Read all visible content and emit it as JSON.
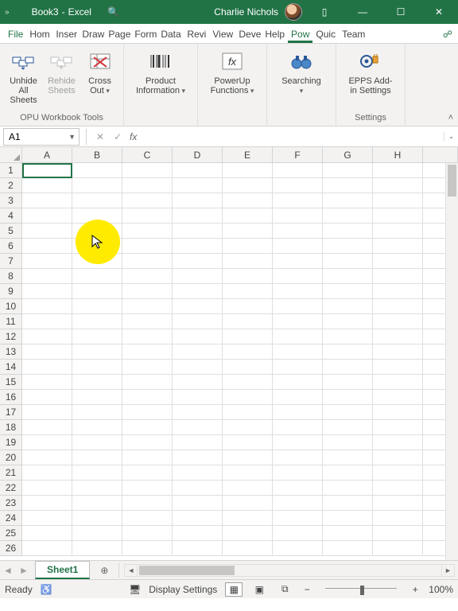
{
  "title": {
    "doc": "Book3",
    "app": "Excel",
    "user": "Charlie Nichols"
  },
  "window": {
    "hist": "»"
  },
  "menu": {
    "file": "File",
    "tabs": [
      "Hom",
      "Inser",
      "Draw",
      "Page",
      "Form",
      "Data",
      "Revi",
      "View",
      "Deve",
      "Help",
      "Pow",
      "Quic",
      "Team"
    ],
    "active_index": 10
  },
  "ribbon": {
    "group1": {
      "label": "OPU Workbook Tools",
      "btn1": {
        "l1": "Unhide",
        "l2": "All Sheets"
      },
      "btn2": {
        "l1": "Rehide",
        "l2": "Sheets"
      },
      "btn3": {
        "l1": "Cross",
        "l2": "Out"
      }
    },
    "group2": {
      "btn": {
        "l1": "Product",
        "l2": "Information"
      }
    },
    "group3": {
      "btn": {
        "l1": "PowerUp",
        "l2": "Functions"
      }
    },
    "group4": {
      "btn": {
        "l1": "Searching",
        "l2": ""
      }
    },
    "group5": {
      "label": "Settings",
      "btn": {
        "l1": "EPPS Add-",
        "l2": "in Settings"
      }
    }
  },
  "formula": {
    "namebox": "A1",
    "value": ""
  },
  "grid": {
    "cols": [
      "A",
      "B",
      "C",
      "D",
      "E",
      "F",
      "G",
      "H"
    ],
    "rows": 26
  },
  "sheets": {
    "active": "Sheet1"
  },
  "status": {
    "ready": "Ready",
    "display": "Display Settings",
    "zoom": "100%"
  },
  "icons": {
    "search": "🔍",
    "ribbon_opts": "▯",
    "minimize": "—",
    "maximize": "☐",
    "close": "✕",
    "cancel": "✕",
    "enter": "✓",
    "fx": "fx",
    "add": "⊕",
    "share": "☍",
    "normal": "▦",
    "layout": "▣",
    "pagebreak": "⧉",
    "minus": "−",
    "plus": "+",
    "display": "🖥",
    "acc": "♿",
    "prev": "◄",
    "next": "►",
    "collapse": "˄",
    "cursor": "↖"
  }
}
